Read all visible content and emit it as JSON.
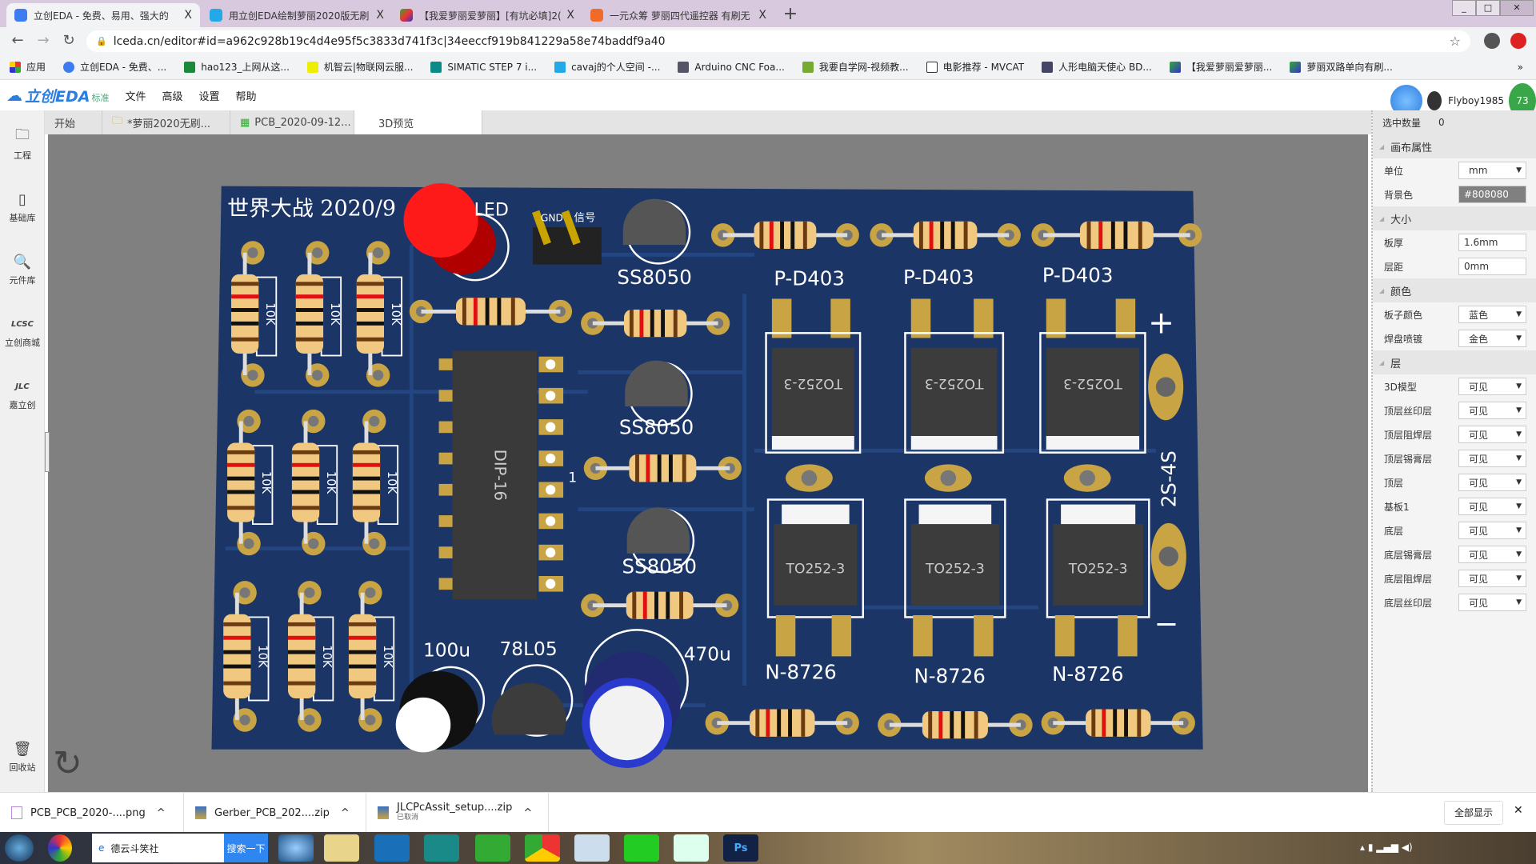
{
  "browser": {
    "tabs": [
      {
        "title": "立创EDA - 免费、易用、强大的",
        "close": "X",
        "active": true
      },
      {
        "title": "用立创EDA绘制萝丽2020版无刷",
        "close": "X"
      },
      {
        "title": "【我爱萝丽爱萝丽】[有坑必填]2(",
        "close": "X"
      },
      {
        "title": "一元众筹 萝丽四代遥控器 有刷无",
        "close": "X"
      }
    ],
    "new_tab": "+",
    "url": "lceda.cn/editor#id=a962c928b19c4d4e95f5c3833d741f3c|34eeccf919b841229a58e74baddf9a40",
    "bookmarks": [
      "应用",
      "立创EDA - 免费、...",
      "hao123_上网从这...",
      "机智云|物联网云服...",
      "SIMATIC STEP 7 i...",
      "cavaj的个人空间 -...",
      "Arduino CNC Foa...",
      "我要自学网-视频教...",
      "电影推荐 - MVCAT",
      "人形电脑天使心 BD...",
      "【我爱萝丽爱萝丽...",
      "萝丽双路单向有刷..."
    ],
    "bookmarks_more": "»"
  },
  "app": {
    "logo": "立创EDA",
    "edition": "标准",
    "menu": [
      "文件",
      "高级",
      "设置",
      "帮助"
    ],
    "user": "Flyboy1985",
    "badge": "73",
    "doc_tabs": [
      {
        "label": "开始"
      },
      {
        "label": "*萝丽2020无刷..."
      },
      {
        "label": "PCB_2020-09-12..."
      },
      {
        "label": "3D预览",
        "active": true
      }
    ],
    "sidebar": [
      "工程",
      "基础库",
      "元件库",
      "立创商城",
      "嘉立创"
    ],
    "trash": "回收站"
  },
  "panel": {
    "selected_label": "选中数量",
    "selected_value": "0",
    "rows": [
      {
        "type": "section",
        "label": "画布属性"
      },
      {
        "label": "单位",
        "value": "mm",
        "select": true
      },
      {
        "label": "背景色",
        "value": "#808080",
        "color": "#808080"
      },
      {
        "type": "section",
        "label": "大小"
      },
      {
        "label": "板厚",
        "value": "1.6mm"
      },
      {
        "label": "层距",
        "value": "0mm"
      },
      {
        "type": "section",
        "label": "颜色"
      },
      {
        "label": "板子颜色",
        "value": "蓝色",
        "select": true
      },
      {
        "label": "焊盘喷镀",
        "value": "金色",
        "select": true
      },
      {
        "type": "section",
        "label": "层"
      },
      {
        "label": "3D模型",
        "value": "可见",
        "select": true
      },
      {
        "label": "顶层丝印层",
        "value": "可见",
        "select": true
      },
      {
        "label": "顶层阻焊层",
        "value": "可见",
        "select": true
      },
      {
        "label": "顶层锡膏层",
        "value": "可见",
        "select": true
      },
      {
        "label": "顶层",
        "value": "可见",
        "select": true
      },
      {
        "label": "基板1",
        "value": "可见",
        "select": true
      },
      {
        "label": "底层",
        "value": "可见",
        "select": true
      },
      {
        "label": "底层锡膏层",
        "value": "可见",
        "select": true
      },
      {
        "label": "底层阻焊层",
        "value": "可见",
        "select": true
      },
      {
        "label": "底层丝印层",
        "value": "可见",
        "select": true
      }
    ]
  },
  "pcb": {
    "board_color": "#1b3566",
    "pad_color": "#c9a444",
    "title": "世界大战 2020/9",
    "led": "LED",
    "gnd": "GND",
    "signal": "信号",
    "transistors": [
      "SS8050",
      "SS8050",
      "SS8050"
    ],
    "p_mos": [
      "P-D403",
      "P-D403",
      "P-D403"
    ],
    "n_mos": [
      "N-8726",
      "N-8726",
      "N-8726"
    ],
    "package": "TO252-3",
    "ic": "DIP-16",
    "pin1": "1",
    "cap1": "100u",
    "regulator": "78L05",
    "cap2": "470u",
    "battery": "2S-4S",
    "plus": "+",
    "minus": "−",
    "resistor": "10K"
  },
  "downloads": {
    "items": [
      {
        "name": "PCB_PCB_2020-....png"
      },
      {
        "name": "Gerber_PCB_202....zip"
      },
      {
        "name": "JLCPcAssit_setup....zip",
        "status": "已取消"
      }
    ],
    "show_all": "全部显示",
    "close": "✕"
  },
  "taskbar": {
    "search_text": "德云斗笑社",
    "search_button": "搜索一下"
  }
}
